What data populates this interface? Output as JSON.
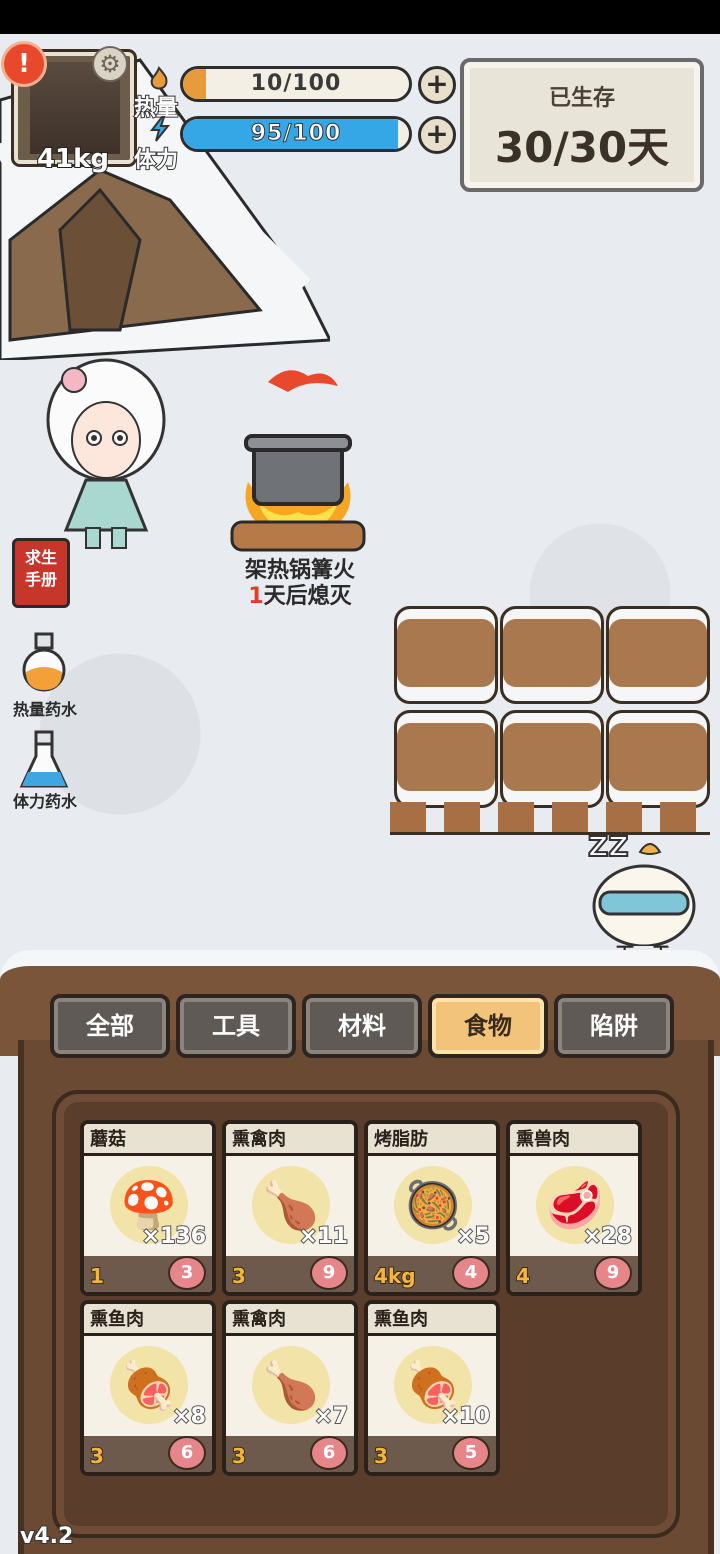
{
  "player": {
    "weight": "41kg"
  },
  "stats": {
    "heat": {
      "label": "热量",
      "value": "10/100",
      "fill": 0.1,
      "color": "#e69c3d"
    },
    "stamina": {
      "label": "体力",
      "value": "95/100",
      "fill": 0.95,
      "color": "#35a6e6"
    }
  },
  "survival": {
    "title": "已生存",
    "count": "30/30天"
  },
  "campfire": {
    "label": "架热锅篝火",
    "days": "1",
    "suffix": "天后熄灭"
  },
  "side_buttons": {
    "handbook": "求生\n手册",
    "heat_potion": "热量药水",
    "stamina_potion": "体力药水"
  },
  "next_day": "下一天",
  "tabs": [
    {
      "label": "全部",
      "active": false
    },
    {
      "label": "工具",
      "active": false
    },
    {
      "label": "材料",
      "active": false
    },
    {
      "label": "食物",
      "active": true
    },
    {
      "label": "陷阱",
      "active": false
    }
  ],
  "items": [
    {
      "name": "蘑菇",
      "icon": "mushroom-icon",
      "glyph": "🍄",
      "qty": "×136",
      "heat": "1",
      "fullness": "3"
    },
    {
      "name": "熏禽肉",
      "icon": "drumstick-icon",
      "glyph": "🍗",
      "qty": "×11",
      "heat": "3",
      "fullness": "9"
    },
    {
      "name": "烤脂肪",
      "icon": "fried-fat-icon",
      "glyph": "🥘",
      "qty": "×5",
      "heat": "4kg",
      "fullness": "4"
    },
    {
      "name": "熏兽肉",
      "icon": "meat-icon",
      "glyph": "🥩",
      "qty": "×28",
      "heat": "4",
      "fullness": "9"
    },
    {
      "name": "熏鱼肉",
      "icon": "fish-steak-icon",
      "glyph": "🍖",
      "qty": "×8",
      "heat": "3",
      "fullness": "6"
    },
    {
      "name": "熏禽肉",
      "icon": "drumstick-icon",
      "glyph": "🍗",
      "qty": "×7",
      "heat": "3",
      "fullness": "6"
    },
    {
      "name": "熏鱼肉",
      "icon": "fish-steak-icon",
      "glyph": "🍖",
      "qty": "×10",
      "heat": "3",
      "fullness": "5"
    }
  ],
  "version": "v4.2"
}
